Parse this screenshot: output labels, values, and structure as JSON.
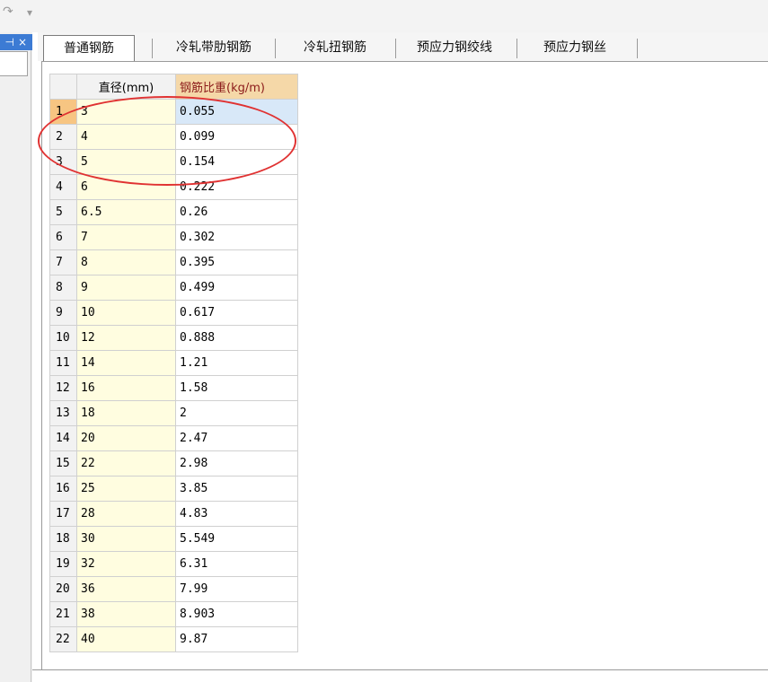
{
  "toolbar": {
    "redo_icon": "↷",
    "dropdown_icon": "▾"
  },
  "left_panel": {
    "pin_icon": "⊣",
    "close_icon": "×"
  },
  "tabs": [
    {
      "label": "普通钢筋",
      "active": true
    },
    {
      "label": "冷轧带肋钢筋",
      "active": false
    },
    {
      "label": "冷轧扭钢筋",
      "active": false
    },
    {
      "label": "预应力钢绞线",
      "active": false
    },
    {
      "label": "预应力钢丝",
      "active": false
    }
  ],
  "table": {
    "headers": {
      "corner": "",
      "diameter": "直径(mm)",
      "weight": "钢筋比重(kg/m)"
    },
    "selected_row": 1,
    "rows": [
      {
        "n": "1",
        "d": "3",
        "w": "0.055"
      },
      {
        "n": "2",
        "d": "4",
        "w": "0.099"
      },
      {
        "n": "3",
        "d": "5",
        "w": "0.154"
      },
      {
        "n": "4",
        "d": "6",
        "w": "0.222"
      },
      {
        "n": "5",
        "d": "6.5",
        "w": "0.26"
      },
      {
        "n": "6",
        "d": "7",
        "w": "0.302"
      },
      {
        "n": "7",
        "d": "8",
        "w": "0.395"
      },
      {
        "n": "8",
        "d": "9",
        "w": "0.499"
      },
      {
        "n": "9",
        "d": "10",
        "w": "0.617"
      },
      {
        "n": "10",
        "d": "12",
        "w": "0.888"
      },
      {
        "n": "11",
        "d": "14",
        "w": "1.21"
      },
      {
        "n": "12",
        "d": "16",
        "w": "1.58"
      },
      {
        "n": "13",
        "d": "18",
        "w": "2"
      },
      {
        "n": "14",
        "d": "20",
        "w": "2.47"
      },
      {
        "n": "15",
        "d": "22",
        "w": "2.98"
      },
      {
        "n": "16",
        "d": "25",
        "w": "3.85"
      },
      {
        "n": "17",
        "d": "28",
        "w": "4.83"
      },
      {
        "n": "18",
        "d": "30",
        "w": "5.549"
      },
      {
        "n": "19",
        "d": "32",
        "w": "6.31"
      },
      {
        "n": "20",
        "d": "36",
        "w": "7.99"
      },
      {
        "n": "21",
        "d": "38",
        "w": "8.903"
      },
      {
        "n": "22",
        "d": "40",
        "w": "9.87"
      }
    ]
  },
  "colors": {
    "annotation": "#e03232",
    "header_weight_bg": "#f5d8a8",
    "diameter_bg": "#fffde0"
  }
}
